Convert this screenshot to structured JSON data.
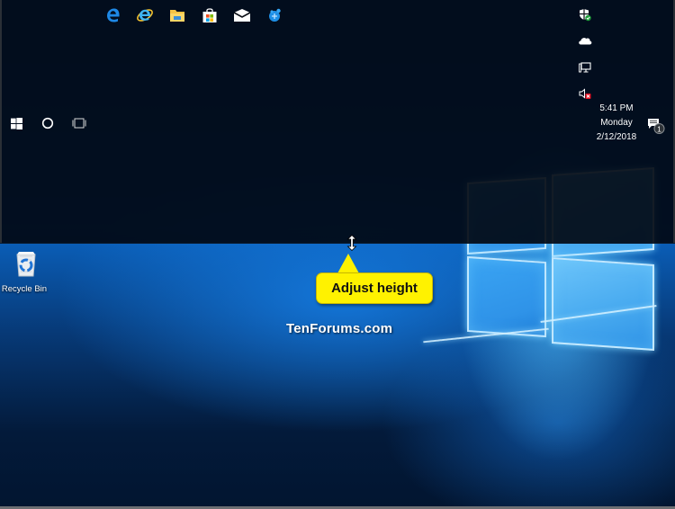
{
  "taskbar": {
    "position": "top",
    "start_button": {
      "icon": "windows-logo-icon",
      "label": "Start"
    },
    "search_button": {
      "icon": "cortana-circle-icon",
      "label": "Search"
    },
    "task_view_button": {
      "icon": "task-view-icon",
      "label": "Task View"
    },
    "pinned_apps": [
      {
        "name": "Microsoft Edge",
        "icon": "edge-icon"
      },
      {
        "name": "Internet Explorer",
        "icon": "internet-explorer-icon"
      },
      {
        "name": "File Explorer",
        "icon": "file-explorer-icon"
      },
      {
        "name": "Microsoft Store",
        "icon": "store-icon"
      },
      {
        "name": "Mail",
        "icon": "mail-icon"
      },
      {
        "name": "App",
        "icon": "app-icon"
      }
    ],
    "tray_icons": [
      {
        "name": "Windows Defender",
        "icon": "defender-shield-icon"
      },
      {
        "name": "OneDrive",
        "icon": "onedrive-cloud-icon"
      },
      {
        "name": "Network",
        "icon": "network-icon"
      },
      {
        "name": "Volume muted",
        "icon": "volume-muted-icon"
      }
    ],
    "clock": {
      "time": "5:41 PM",
      "day": "Monday",
      "date": "2/12/2018"
    },
    "action_center": {
      "icon": "action-center-icon",
      "badge": "1"
    }
  },
  "desktop": {
    "icons": [
      {
        "label": "Recycle Bin",
        "icon": "recycle-bin-icon"
      }
    ]
  },
  "annotation": {
    "callout_text": "Adjust height",
    "callout_color": "#fff200",
    "cursor": "resize-vertical-cursor"
  },
  "watermark": "TenForums.com"
}
